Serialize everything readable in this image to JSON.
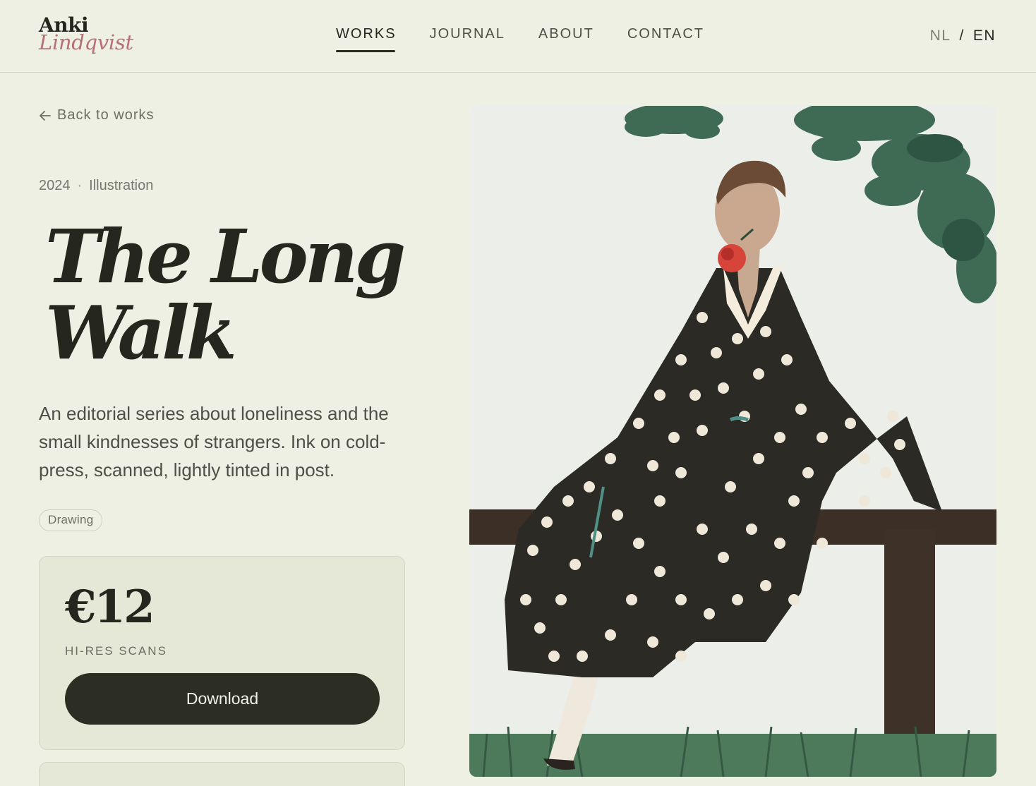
{
  "header": {
    "logo_first": "Anki",
    "logo_last": "Lindqvist",
    "nav": [
      {
        "label": "WORKS",
        "active": true
      },
      {
        "label": "JOURNAL",
        "active": false
      },
      {
        "label": "ABOUT",
        "active": false
      },
      {
        "label": "CONTACT",
        "active": false
      }
    ],
    "lang": {
      "nl": "NL",
      "sep": "/",
      "en": "EN",
      "active": "EN"
    }
  },
  "work": {
    "back_label": "Back to works",
    "year": "2024",
    "category": "Illustration",
    "title_line1": "The Long",
    "title_line2": "Walk",
    "description": "An editorial series about loneliness and the small kindnesses of strangers. Ink on cold-press, scanned, lightly tinted in post.",
    "tag": "Drawing"
  },
  "purchase": {
    "price": "€12",
    "label": "HI-RES SCANS",
    "button_label": "Download"
  },
  "colors": {
    "background": "#eff0e4",
    "ink": "#2a2c24",
    "accent_rose": "#b76f76",
    "card": "#e5e7d7"
  },
  "icons": {
    "back": "arrow-left-icon"
  }
}
